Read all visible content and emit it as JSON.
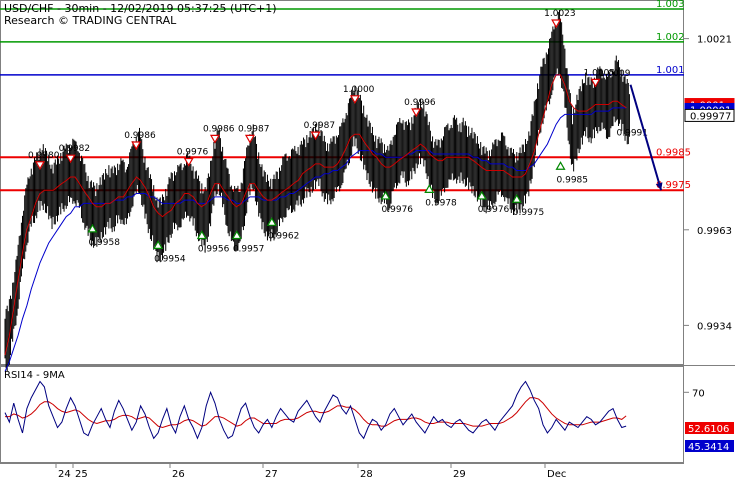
{
  "title": "USD/CHF - 30min - 12/02/2019 05:37:25 (UTC+1)",
  "subtitle": "Research © TRADING CENTRAL",
  "colors": {
    "price": "#000000",
    "ma_fast": "#cc0000",
    "ma_slow": "#0000cc",
    "resistance_green": "#009900",
    "pivot_blue": "#0000cc",
    "support_red": "#ee0000",
    "peak_marker": "#dd0000",
    "trough_marker": "#008800",
    "forecast_arrow": "#000080",
    "rsi_line": "#000080",
    "rsi_ma": "#cc0000"
  },
  "chart_data": [
    {
      "type": "line",
      "panel": "price",
      "ylim": [
        0.99235,
        1.00315
      ],
      "y_ticks": [
        "1.0021",
        "0.9963",
        "0.9934"
      ],
      "x_ticks": [
        "24",
        "25",
        "26",
        "27",
        "28",
        "29",
        "Dec"
      ],
      "levels": [
        {
          "label": "1.003",
          "value": 1.003,
          "color": "#009900"
        },
        {
          "label": "1.002",
          "value": 1.002,
          "color": "#009900"
        },
        {
          "label": "1.001",
          "value": 1.001,
          "color": "#0000cc"
        },
        {
          "label": "0.9985",
          "value": 0.9985,
          "color": "#ee0000"
        },
        {
          "label": "0.9975",
          "value": 0.9975,
          "color": "#ee0000"
        }
      ],
      "price_tags": [
        {
          "label": "1.0001",
          "value": 1.0001,
          "bg": "#ee0000",
          "fg": "#ffffff"
        },
        {
          "label": "1.00001",
          "value": 0.99995,
          "bg": "#0000cc",
          "fg": "#ffffff"
        },
        {
          "label": "0.99977",
          "value": 0.99977,
          "bg": "#ffffff",
          "fg": "#000000"
        }
      ],
      "peaks": [
        {
          "label": "0.9980",
          "x": 8,
          "value": 0.998
        },
        {
          "label": "0.9982",
          "x": 15,
          "value": 0.9982
        },
        {
          "label": "0.9986",
          "x": 30,
          "value": 0.9986
        },
        {
          "label": "0.9976",
          "x": 42,
          "value": 0.9981
        },
        {
          "label": "0.9986",
          "x": 48,
          "value": 0.9988
        },
        {
          "label": "0.9987",
          "x": 56,
          "value": 0.9988
        },
        {
          "label": "0.9987",
          "x": 71,
          "value": 0.9989
        },
        {
          "label": "1.0000",
          "x": 80,
          "value": 1.0
        },
        {
          "label": "0.9996",
          "x": 94,
          "value": 0.9996
        },
        {
          "label": "1.0023",
          "x": 126,
          "value": 1.0023
        },
        {
          "label": "1.0005",
          "x": 135,
          "value": 1.0005
        }
      ],
      "troughs": [
        {
          "label": "0.9958",
          "x": 20,
          "value": 0.9966
        },
        {
          "label": "0.9954",
          "x": 35,
          "value": 0.9961
        },
        {
          "label": "0.9956",
          "x": 45,
          "value": 0.9964
        },
        {
          "label": "0.9957",
          "x": 53,
          "value": 0.9964
        },
        {
          "label": "0.9962",
          "x": 61,
          "value": 0.9968
        },
        {
          "label": "0.9976",
          "x": 87,
          "value": 0.9976
        },
        {
          "label": "0.9978",
          "x": 97,
          "value": 0.9978
        },
        {
          "label": "0.9976",
          "x": 109,
          "value": 0.9976
        },
        {
          "label": "0.9975",
          "x": 117,
          "value": 0.9975
        },
        {
          "label": "0.9985",
          "x": 127,
          "value": 0.9985
        }
      ],
      "annotations": [
        {
          "label": "1.0009",
          "x": 139,
          "value": 1.0009
        },
        {
          "label": "0.9991",
          "x": 143,
          "value": 0.9991
        }
      ],
      "forecast": {
        "from": [
          143,
          1.0007
        ],
        "to": [
          150,
          0.9975
        ]
      },
      "close": [
        0.993,
        0.9938,
        0.9946,
        0.9957,
        0.9966,
        0.9972,
        0.9975,
        0.9978,
        0.9979,
        0.9977,
        0.9973,
        0.9975,
        0.9977,
        0.9979,
        0.998,
        0.9981,
        0.9979,
        0.9975,
        0.9971,
        0.9968,
        0.9967,
        0.9969,
        0.9971,
        0.9973,
        0.9972,
        0.9974,
        0.9975,
        0.9973,
        0.9978,
        0.9982,
        0.9984,
        0.9977,
        0.9972,
        0.9968,
        0.9963,
        0.9963,
        0.9966,
        0.997,
        0.9972,
        0.9973,
        0.9974,
        0.9977,
        0.9974,
        0.9971,
        0.9968,
        0.9966,
        0.9972,
        0.998,
        0.9985,
        0.9979,
        0.9973,
        0.9968,
        0.9966,
        0.9967,
        0.9974,
        0.9982,
        0.9985,
        0.9978,
        0.9973,
        0.997,
        0.9969,
        0.997,
        0.9973,
        0.9976,
        0.9977,
        0.9978,
        0.9979,
        0.998,
        0.9982,
        0.9983,
        0.9985,
        0.9986,
        0.9982,
        0.998,
        0.9981,
        0.9983,
        0.9985,
        0.9989,
        0.9993,
        0.9998,
        0.9996,
        0.9992,
        0.9988,
        0.9985,
        0.9982,
        0.9981,
        0.998,
        0.9978,
        0.9983,
        0.9986,
        0.9988,
        0.9986,
        0.9987,
        0.999,
        0.9993,
        0.9992,
        0.9987,
        0.9982,
        0.998,
        0.9982,
        0.9985,
        0.9986,
        0.9988,
        0.9986,
        0.9987,
        0.9985,
        0.9984,
        0.9982,
        0.998,
        0.9978,
        0.9978,
        0.998,
        0.9982,
        0.9983,
        0.998,
        0.9978,
        0.9977,
        0.9978,
        0.998,
        0.9983,
        0.999,
        0.9998,
        1.0004,
        1.0008,
        1.0012,
        1.0018,
        1.002,
        1.0012,
        1.0,
        0.9989,
        0.9994,
        0.9998,
        1.0001,
        0.9999,
        1.0,
        1.0003,
        1.0002,
        1.0,
        1.0002,
        1.0006,
        1.0003,
        1.0,
        0.99977
      ],
      "ma_fast": [
        0.9925,
        0.9931,
        0.9939,
        0.9948,
        0.9956,
        0.9963,
        0.9967,
        0.9971,
        0.9974,
        0.9975,
        0.9975,
        0.9975,
        0.9976,
        0.9977,
        0.9978,
        0.9979,
        0.9979,
        0.9977,
        0.9975,
        0.9973,
        0.9971,
        0.997,
        0.997,
        0.9971,
        0.9971,
        0.9972,
        0.9973,
        0.9973,
        0.9975,
        0.9977,
        0.9979,
        0.9978,
        0.9976,
        0.9973,
        0.997,
        0.9968,
        0.9967,
        0.9968,
        0.9969,
        0.9971,
        0.9972,
        0.9974,
        0.9974,
        0.9973,
        0.9971,
        0.997,
        0.9971,
        0.9974,
        0.9977,
        0.9977,
        0.9975,
        0.9973,
        0.9971,
        0.997,
        0.9971,
        0.9974,
        0.9977,
        0.9977,
        0.9975,
        0.9973,
        0.9972,
        0.9972,
        0.9973,
        0.9974,
        0.9975,
        0.9976,
        0.9977,
        0.9978,
        0.998,
        0.9981,
        0.9982,
        0.9983,
        0.9983,
        0.9982,
        0.9982,
        0.9982,
        0.9983,
        0.9985,
        0.9988,
        0.9991,
        0.9992,
        0.9992,
        0.999,
        0.9988,
        0.9986,
        0.9985,
        0.9983,
        0.9982,
        0.9982,
        0.9983,
        0.9984,
        0.9985,
        0.9986,
        0.9987,
        0.9988,
        0.9989,
        0.9988,
        0.9986,
        0.9985,
        0.9984,
        0.9984,
        0.9985,
        0.9985,
        0.9985,
        0.9985,
        0.9985,
        0.9985,
        0.9984,
        0.9983,
        0.9982,
        0.9981,
        0.9981,
        0.9981,
        0.9981,
        0.9981,
        0.998,
        0.9979,
        0.9979,
        0.9979,
        0.998,
        0.9983,
        0.9987,
        0.9992,
        0.9997,
        1.0002,
        1.0007,
        1.001,
        1.001,
        1.0007,
        1.0002,
        1.0,
        0.9999,
        0.9999,
        0.9999,
        1.0,
        1.0001,
        1.0001,
        1.0001,
        1.0001,
        1.0002,
        1.0002,
        1.0001,
        1.0
      ],
      "ma_slow": [
        0.992,
        0.9923,
        0.9927,
        0.9931,
        0.9936,
        0.994,
        0.9945,
        0.9949,
        0.9953,
        0.9956,
        0.9959,
        0.9961,
        0.9963,
        0.9965,
        0.9967,
        0.9968,
        0.997,
        0.997,
        0.9971,
        0.9971,
        0.9971,
        0.9971,
        0.9971,
        0.9971,
        0.9971,
        0.9972,
        0.9972,
        0.9972,
        0.9973,
        0.9973,
        0.9974,
        0.9974,
        0.9974,
        0.9973,
        0.9973,
        0.9972,
        0.9971,
        0.9971,
        0.9971,
        0.9971,
        0.9971,
        0.9972,
        0.9972,
        0.9972,
        0.9971,
        0.9971,
        0.9971,
        0.9972,
        0.9973,
        0.9973,
        0.9973,
        0.9972,
        0.9972,
        0.9971,
        0.9971,
        0.9972,
        0.9973,
        0.9973,
        0.9973,
        0.9972,
        0.9972,
        0.9972,
        0.9972,
        0.9973,
        0.9973,
        0.9974,
        0.9974,
        0.9975,
        0.9976,
        0.9977,
        0.9978,
        0.9979,
        0.9979,
        0.998,
        0.998,
        0.9981,
        0.9981,
        0.9982,
        0.9983,
        0.9985,
        0.9986,
        0.9987,
        0.9987,
        0.9987,
        0.9987,
        0.9986,
        0.9986,
        0.9985,
        0.9985,
        0.9985,
        0.9985,
        0.9985,
        0.9986,
        0.9986,
        0.9987,
        0.9987,
        0.9987,
        0.9987,
        0.9986,
        0.9986,
        0.9986,
        0.9986,
        0.9986,
        0.9986,
        0.9986,
        0.9986,
        0.9986,
        0.9985,
        0.9985,
        0.9984,
        0.9984,
        0.9983,
        0.9983,
        0.9983,
        0.9983,
        0.9982,
        0.9982,
        0.9981,
        0.9981,
        0.9981,
        0.9982,
        0.9983,
        0.9985,
        0.9987,
        0.9989,
        0.9992,
        0.9995,
        0.9997,
        0.9998,
        0.9998,
        0.9998,
        0.9998,
        0.9998,
        0.9998,
        0.9998,
        0.9999,
        0.9999,
        0.9999,
        0.9999,
        1.0,
        1.0,
        1.0,
        1.0
      ]
    },
    {
      "type": "line",
      "panel": "rsi",
      "title": "RSI14 - 9MA",
      "ylim": [
        20,
        85
      ],
      "y_ticks": [
        "70"
      ],
      "value_tags": [
        {
          "label": "52.6106",
          "value": 52.61,
          "bg": "#ee0000",
          "fg": "#ffffff"
        },
        {
          "label": "45.3414",
          "value": 45.34,
          "bg": "#0000cc",
          "fg": "#ffffff"
        }
      ],
      "rsi": [
        55,
        48,
        62,
        50,
        40,
        58,
        66,
        72,
        78,
        74,
        60,
        52,
        44,
        48,
        58,
        66,
        60,
        50,
        40,
        38,
        46,
        52,
        58,
        50,
        44,
        56,
        64,
        58,
        50,
        42,
        48,
        60,
        54,
        44,
        36,
        40,
        50,
        58,
        46,
        40,
        52,
        60,
        50,
        44,
        36,
        44,
        60,
        70,
        62,
        50,
        42,
        36,
        38,
        48,
        58,
        62,
        52,
        44,
        40,
        46,
        50,
        44,
        52,
        58,
        54,
        50,
        48,
        56,
        60,
        64,
        58,
        52,
        48,
        56,
        62,
        68,
        66,
        58,
        54,
        60,
        50,
        40,
        36,
        44,
        50,
        48,
        42,
        46,
        54,
        58,
        52,
        46,
        50,
        54,
        48,
        44,
        40,
        46,
        52,
        48,
        50,
        46,
        44,
        48,
        50,
        46,
        42,
        40,
        44,
        48,
        50,
        46,
        42,
        48,
        52,
        56,
        60,
        68,
        74,
        78,
        72,
        64,
        58,
        46,
        40,
        44,
        50,
        46,
        42,
        48,
        46,
        44,
        48,
        52,
        50,
        46,
        48,
        52,
        56,
        58,
        50,
        44,
        45
      ],
      "rsi_ma": [
        52,
        52,
        54,
        53,
        51,
        52,
        54,
        57,
        61,
        63,
        63,
        61,
        58,
        56,
        55,
        56,
        57,
        56,
        53,
        50,
        48,
        47,
        48,
        49,
        49,
        50,
        52,
        53,
        53,
        52,
        50,
        51,
        52,
        51,
        48,
        45,
        44,
        45,
        46,
        46,
        47,
        49,
        50,
        49,
        47,
        45,
        46,
        49,
        52,
        52,
        51,
        49,
        47,
        45,
        46,
        49,
        51,
        51,
        49,
        47,
        47,
        47,
        47,
        49,
        50,
        50,
        50,
        51,
        53,
        55,
        56,
        56,
        55,
        55,
        56,
        58,
        60,
        60,
        59,
        59,
        57,
        54,
        50,
        47,
        46,
        46,
        45,
        45,
        47,
        49,
        50,
        50,
        50,
        51,
        51,
        50,
        48,
        47,
        47,
        48,
        48,
        48,
        47,
        47,
        47,
        47,
        46,
        45,
        45,
        45,
        46,
        47,
        47,
        47,
        48,
        50,
        52,
        55,
        59,
        63,
        66,
        66,
        65,
        62,
        58,
        54,
        51,
        49,
        47,
        46,
        46,
        46,
        46,
        47,
        48,
        48,
        48,
        49,
        50,
        51,
        51,
        50,
        52.6
      ]
    }
  ]
}
